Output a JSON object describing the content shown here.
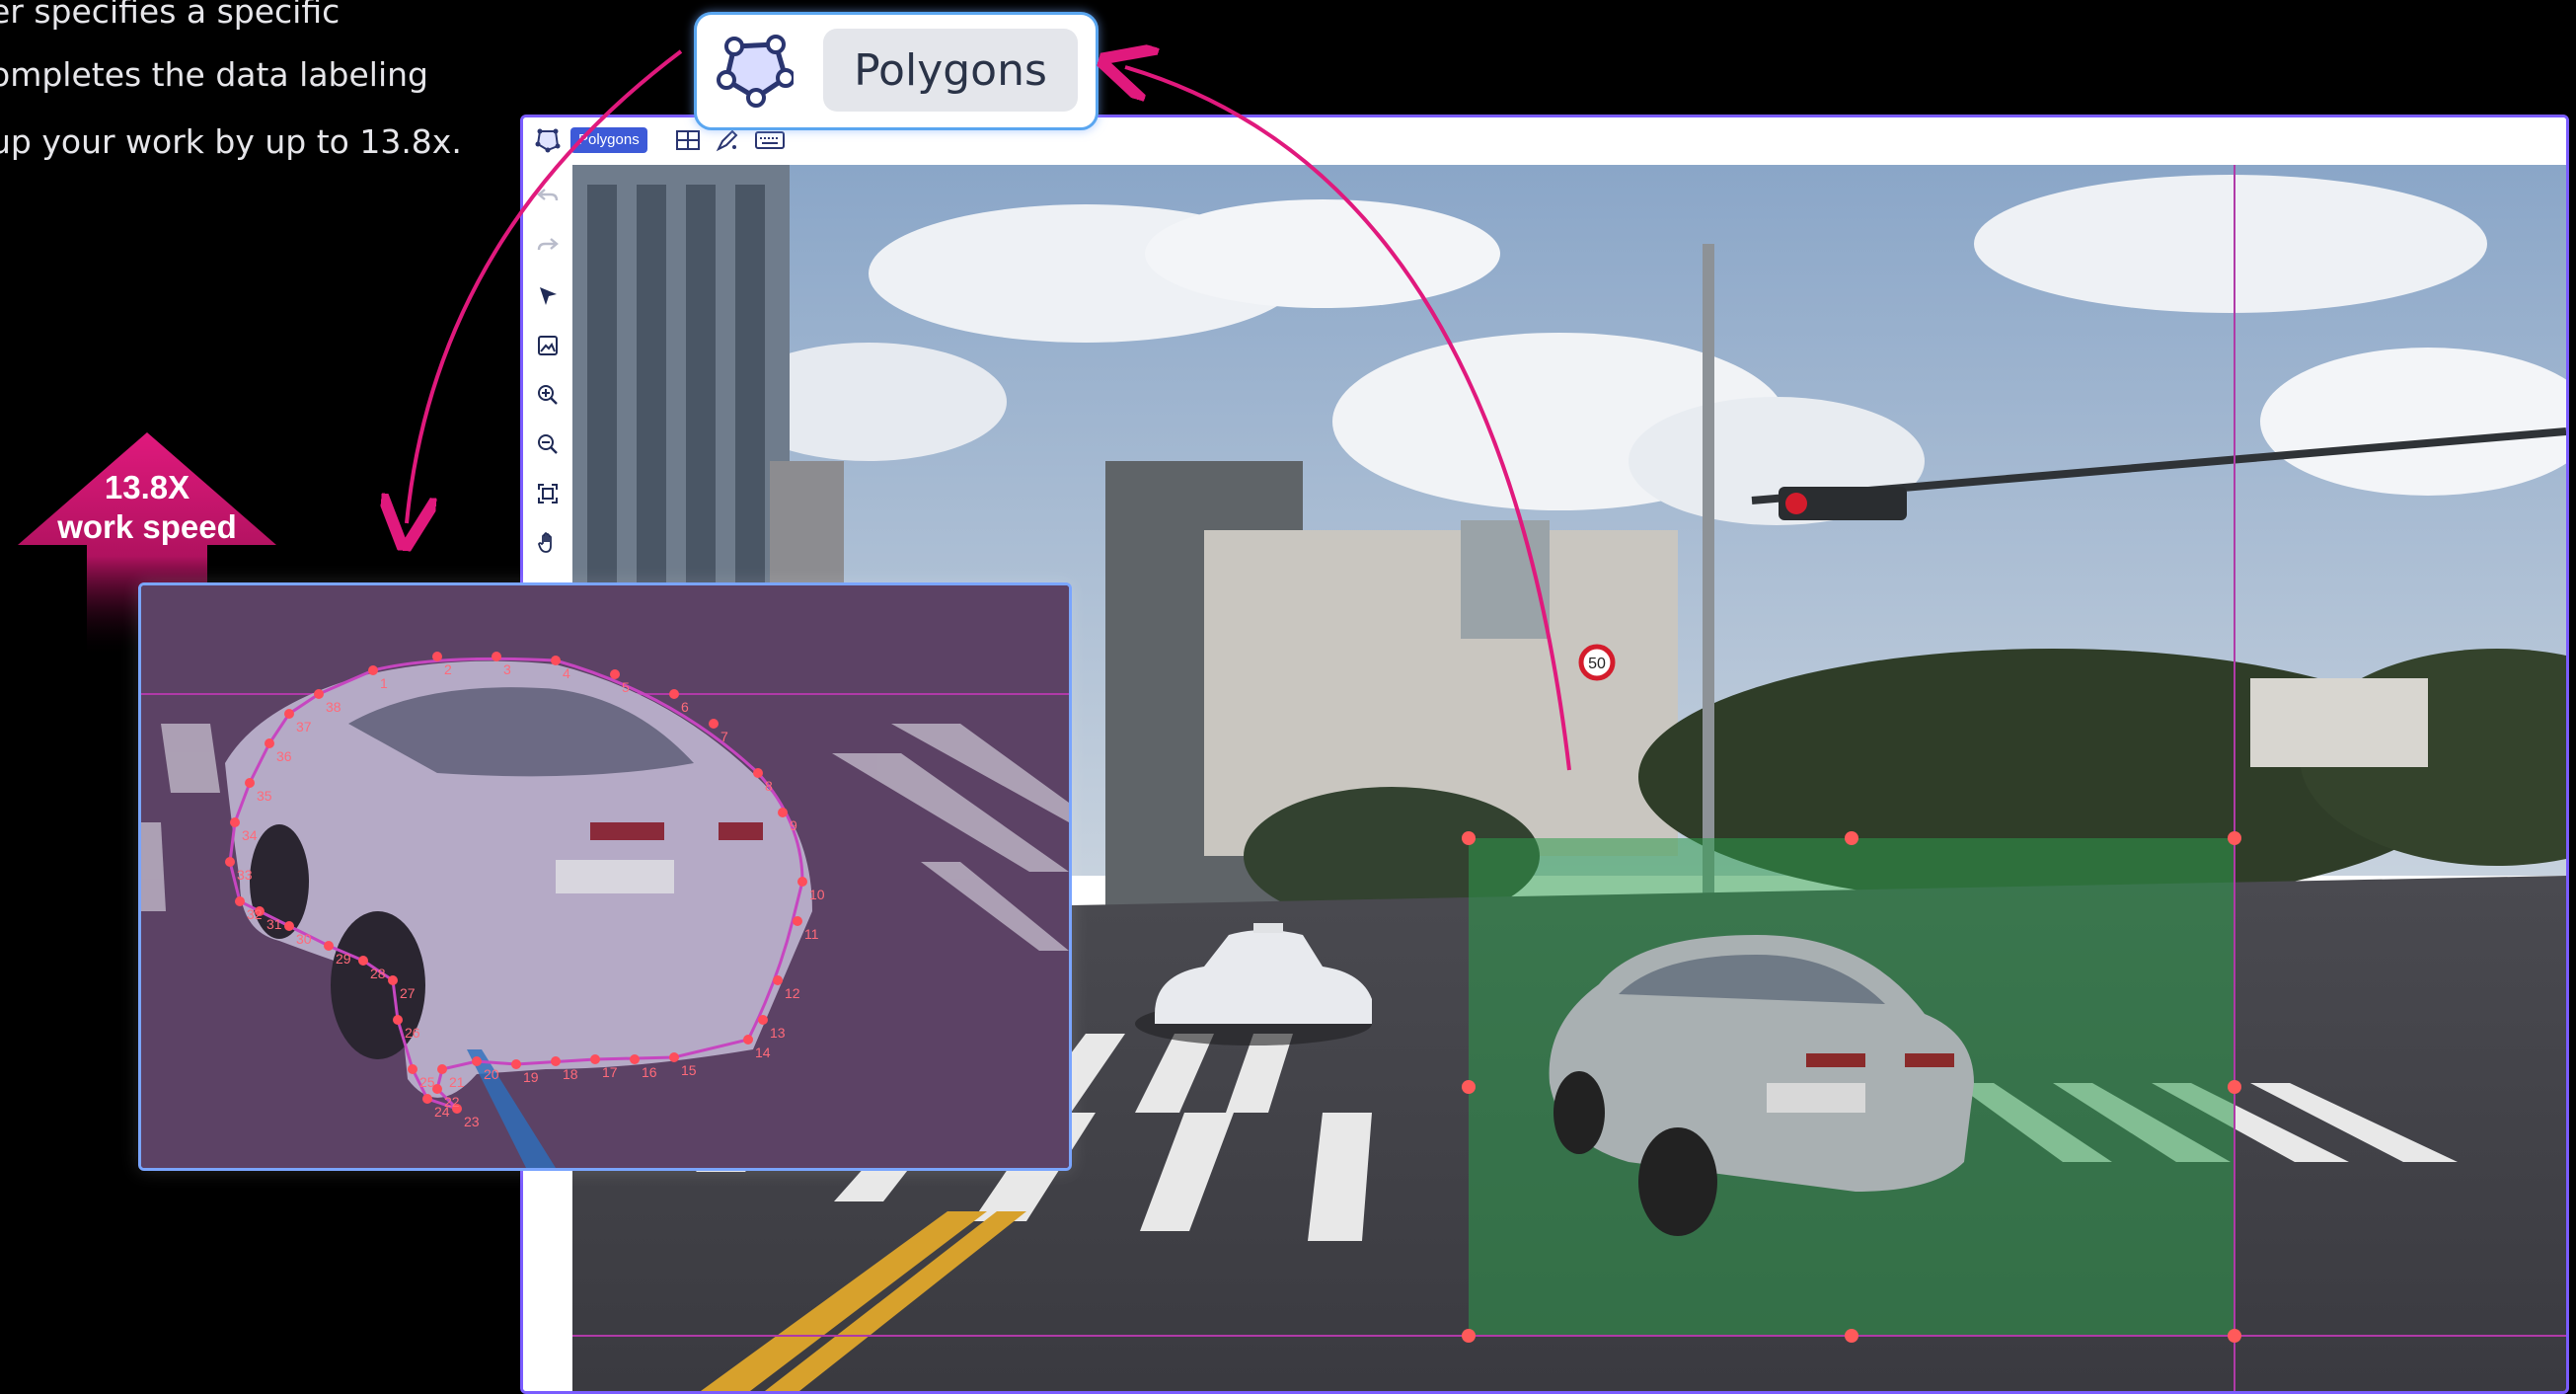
{
  "intro": {
    "line1": "er specifies a specific",
    "line2": "ompletes the data labeling",
    "line3": "up your work by up to 13.8x."
  },
  "speed_badge": {
    "value": "13.8X",
    "caption": "work speed",
    "color": "#d6177a"
  },
  "callout": {
    "label": "Polygons",
    "icon": "polygon-icon",
    "border_color": "#5aa6f0"
  },
  "toolbar": {
    "active_tool": "Polygons",
    "top_icons": [
      "polygon-icon",
      "grid-icon",
      "pen-icon",
      "keyboard-icon"
    ],
    "left_icons": [
      "undo-icon",
      "redo-icon",
      "pointer-icon",
      "image-icon",
      "zoom-in-icon",
      "zoom-out-icon",
      "fit-screen-icon",
      "hand-icon"
    ]
  },
  "signs": {
    "speed_limit": "50"
  },
  "polygon_points": {
    "labels": [
      "1",
      "2",
      "3",
      "4",
      "5",
      "6",
      "7",
      "8",
      "9",
      "10",
      "11",
      "12",
      "13",
      "14",
      "15",
      "16",
      "17",
      "18",
      "19",
      "20",
      "21",
      "22",
      "23",
      "24",
      "25",
      "26",
      "27",
      "28",
      "29",
      "30",
      "31",
      "32",
      "33",
      "34",
      "35",
      "36",
      "37",
      "38"
    ]
  },
  "colors": {
    "accent_pink": "#e0197d",
    "polygon_purple": "#b03aa8",
    "box_green": "#2e9a4c",
    "window_border": "#7a5cff"
  }
}
